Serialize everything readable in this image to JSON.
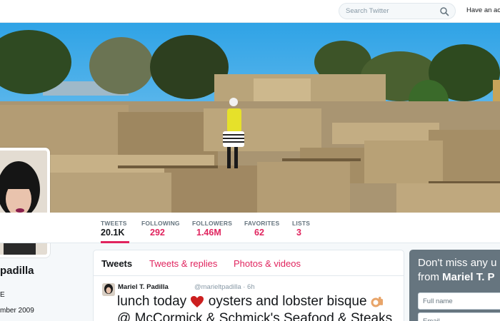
{
  "search": {
    "placeholder": "Search Twitter",
    "icon": "search-icon"
  },
  "header": {
    "account_prompt": "Have an acc"
  },
  "profile": {
    "name": "padilla",
    "partial_text": "E",
    "joined": "mber 2009"
  },
  "stats": [
    {
      "label": "TWEETS",
      "value": "20.1K"
    },
    {
      "label": "FOLLOWING",
      "value": "292"
    },
    {
      "label": "FOLLOWERS",
      "value": "1.46M"
    },
    {
      "label": "FAVORITES",
      "value": "62"
    },
    {
      "label": "LISTS",
      "value": "3"
    }
  ],
  "timeline": {
    "tabs": [
      {
        "label": "Tweets"
      },
      {
        "label": "Tweets & replies"
      },
      {
        "label": "Photos & videos"
      }
    ],
    "tweet": {
      "author": "Mariel T. Padilla",
      "meta": "@marieltpadilla · 6h",
      "text_part1": "lunch today",
      "text_part2": "oysters and lobster bisque",
      "text_line2": "@ McCormick & Schmick's Seafood & Steaks",
      "emoji_1": "heart-icon",
      "emoji_2": "ok-hand-icon"
    }
  },
  "signup": {
    "line1": "Don't miss any u",
    "line2_prefix": "from",
    "line2_name": "Mariel T. P",
    "fullname_placeholder": "Full name",
    "email_placeholder": "Email"
  },
  "colors": {
    "accent": "#e0245e",
    "text": "#14171a",
    "muted": "#66757f",
    "signup_bg": "#66757f",
    "page_bg": "#f5f8fa"
  }
}
